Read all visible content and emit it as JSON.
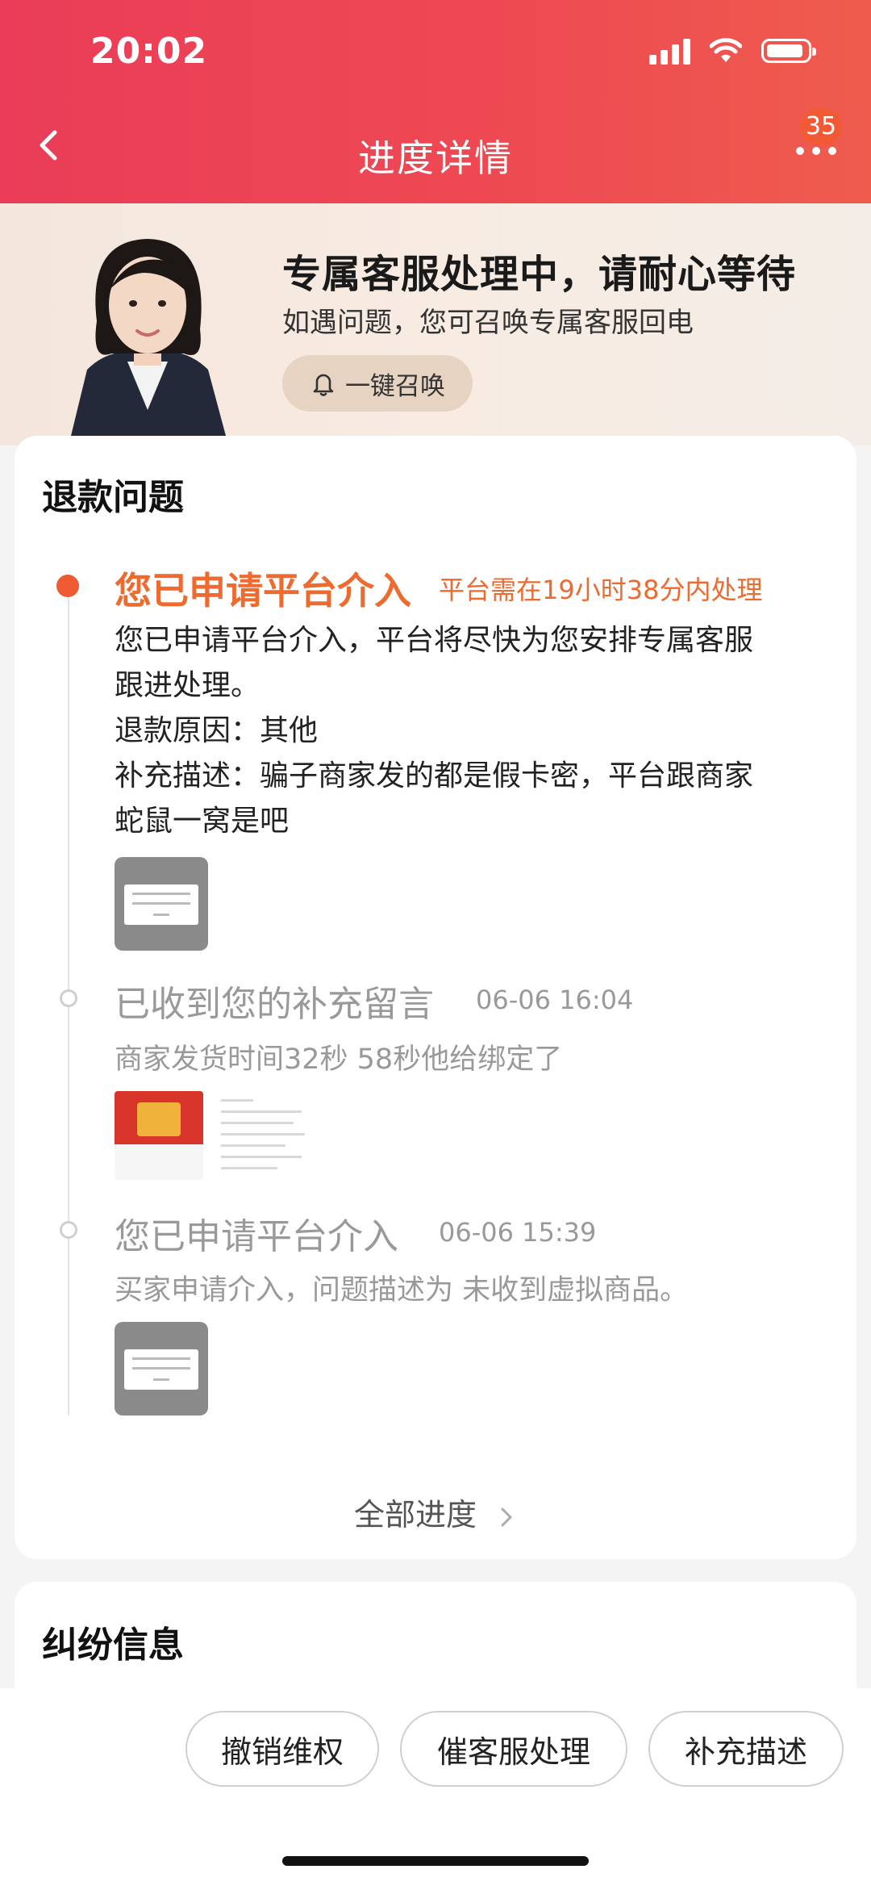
{
  "status_bar": {
    "time": "20:02"
  },
  "header": {
    "title": "进度详情",
    "badge": "35"
  },
  "agent": {
    "title": "专属客服处理中，请耐心等待",
    "subtitle": "如遇问题，您可召唤专属客服回电",
    "call_button": "一键召唤"
  },
  "refund": {
    "section_title": "退款问题",
    "events": [
      {
        "title": "您已申请平台介入",
        "deadline": "平台需在19小时38分内处理",
        "body_lines": [
          "您已申请平台介入，平台将尽快为您安排专属客服",
          "跟进处理。",
          "退款原因：其他",
          "补充描述：骗子商家发的都是假卡密，平台跟商家",
          "蛇鼠一窝是吧"
        ]
      },
      {
        "title": "已收到您的补充留言",
        "time": "06-06 16:04",
        "desc": "商家发货时间32秒 58秒他给绑定了"
      },
      {
        "title": "您已申请平台介入",
        "time": "06-06 15:39",
        "desc": "买家申请介入，问题描述为 未收到虚拟商品。"
      }
    ],
    "all_progress": "全部进度"
  },
  "dispute": {
    "section_title": "纠纷信息"
  },
  "bottom_actions": {
    "cancel": "撤销维权",
    "urge": "催客服处理",
    "supplement": "补充描述"
  },
  "colors": {
    "header_red": "#ea3c58",
    "accent_orange": "#ee6a2e",
    "muted_gray": "#999999"
  }
}
